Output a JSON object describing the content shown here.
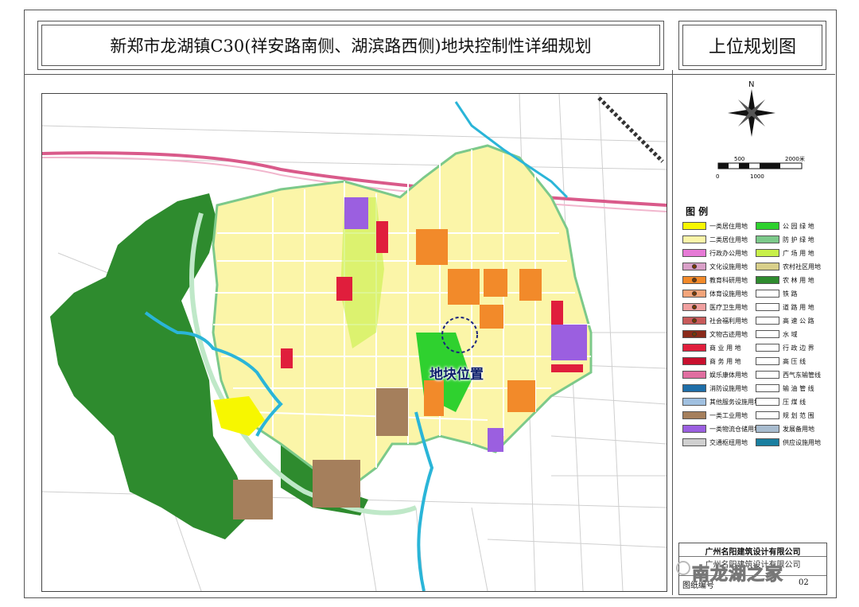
{
  "header": {
    "title": "新郑市龙湖镇C30(祥安路南侧、湖滨路西侧)地块控制性详细规划",
    "subtitle": "上位规划图"
  },
  "map": {
    "site_label": "地块位置"
  },
  "compass": {
    "north_label": "N"
  },
  "scale_bar": {
    "top_labels": [
      "500",
      "2000米"
    ],
    "bottom_labels": [
      "0",
      "1000"
    ]
  },
  "legend": {
    "title": "图 例",
    "items": [
      {
        "label": "一类居住用地",
        "color": "#f7f700"
      },
      {
        "label": "公 园 绿 地",
        "color": "#2fd12f"
      },
      {
        "label": "二类居住用地",
        "color": "#fbf5a8"
      },
      {
        "label": "防 护 绿 地",
        "color": "#7cc98a"
      },
      {
        "label": "行政办公用地",
        "color": "#e67ad6"
      },
      {
        "label": "广 场 用 地",
        "color": "#c8f04a"
      },
      {
        "label": "文化设施用地",
        "color": "#d9a0c8"
      },
      {
        "label": "农村社区用地",
        "color": "#d8cf8a"
      },
      {
        "label": "教育科研用地",
        "color": "#f28a2a"
      },
      {
        "label": "农 林 用 地",
        "color": "#2e8b2e"
      },
      {
        "label": "体育设施用地",
        "color": "#f2a47a"
      },
      {
        "label": "铁          路",
        "color": "#ffffff"
      },
      {
        "label": "医疗卫生用地",
        "color": "#f0a0a0"
      },
      {
        "label": "道 路 用 地",
        "color": "#ffffff"
      },
      {
        "label": "社会福利用地",
        "color": "#c85a5a"
      },
      {
        "label": "高 速 公 路",
        "color": "#ffffff"
      },
      {
        "label": "文物古迹用地",
        "color": "#8a2a1a"
      },
      {
        "label": "水          域",
        "color": "#ffffff"
      },
      {
        "label": "商 业 用 地",
        "color": "#e01e3c"
      },
      {
        "label": "行 政 边 界",
        "color": "#ffffff"
      },
      {
        "label": "商 务 用 地",
        "color": "#c8102e"
      },
      {
        "label": "高    压    线",
        "color": "#ffffff"
      },
      {
        "label": "娱乐康体用地",
        "color": "#e06ea0"
      },
      {
        "label": "西气东输管线",
        "color": "#ffffff"
      },
      {
        "label": "消防设施用地",
        "color": "#1e6ea8"
      },
      {
        "label": "输 油 管 线",
        "color": "#ffffff"
      },
      {
        "label": "其他服务设施用地",
        "color": "#a0c0e0"
      },
      {
        "label": "压    煤    线",
        "color": "#ffffff"
      },
      {
        "label": "一类工业用地",
        "color": "#a57f5c"
      },
      {
        "label": "规 划 范 围",
        "color": "#ffffff"
      },
      {
        "label": "一类物流仓储用地",
        "color": "#9b5fe0"
      },
      {
        "label": "发展备用地",
        "color": "#a8bccf"
      },
      {
        "label": "交通枢纽用地",
        "color": "#d0d0d0"
      },
      {
        "label": "供应设施用地",
        "color": "#1a7fa0"
      }
    ]
  },
  "footer": {
    "company": "广州名阳建筑设计有限公司",
    "company_sub": "广州名阳建筑设计有限公司",
    "drawing_no_label": "图纸编号",
    "drawing_no": "02"
  },
  "watermark": {
    "text": "南龙湖之家"
  }
}
